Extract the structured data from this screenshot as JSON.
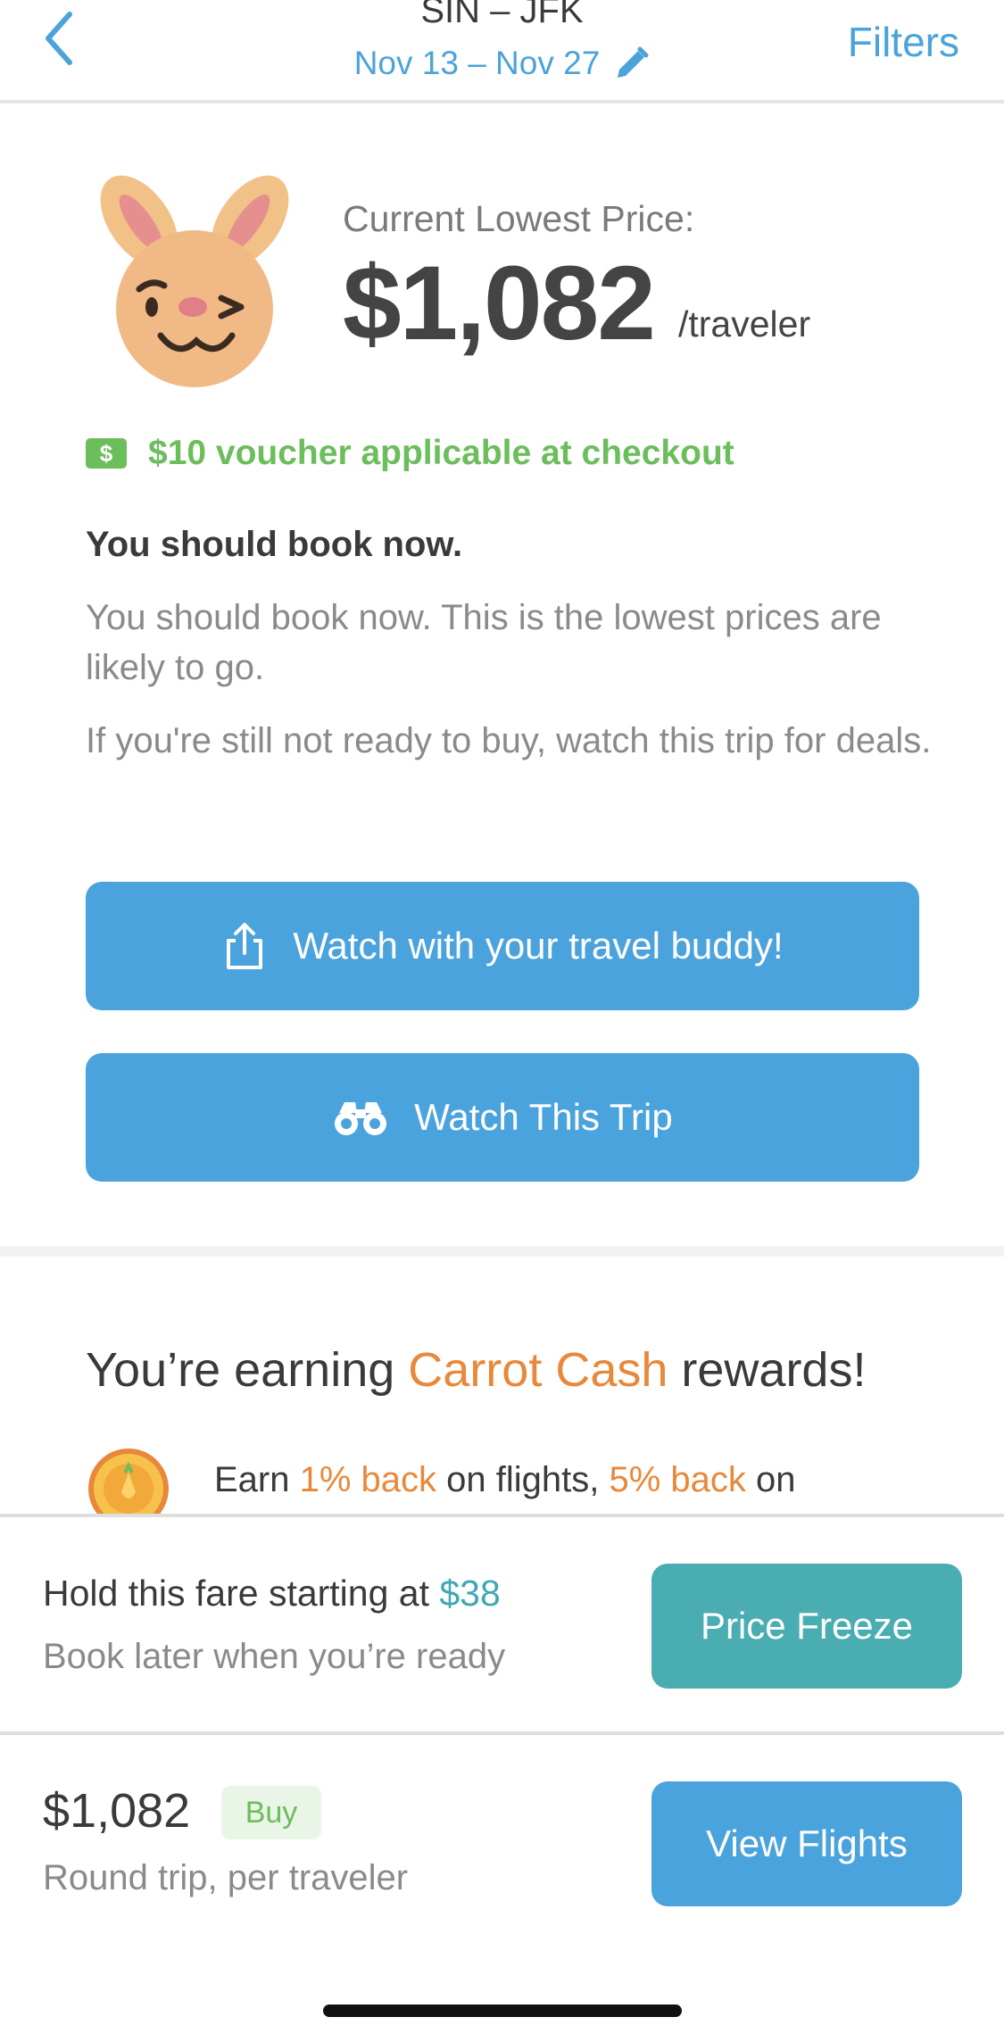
{
  "header": {
    "route": "SIN – JFK",
    "dates": "Nov 13 – Nov 27",
    "filters_label": "Filters"
  },
  "price_card": {
    "label": "Current Lowest Price:",
    "price": "$1,082",
    "unit": "/traveler",
    "voucher_icon_text": "$",
    "voucher_text": "$10 voucher applicable at checkout",
    "advice_title": "You should book now.",
    "advice_1": "You should book now. This is the lowest prices are likely to go.",
    "advice_2": "If you're still not ready to buy, watch this trip for deals.",
    "share_button": "Watch with your travel buddy!",
    "watch_button": "Watch This Trip"
  },
  "rewards": {
    "title_pre": "You’re earning ",
    "title_highlight": "Carrot Cash",
    "title_post": " rewards!",
    "line_1": "Earn ",
    "line_hl_1": "1% back",
    "line_2": " on flights, ",
    "line_hl_2": "5% back",
    "line_3": " on"
  },
  "bottom_sheet": {
    "hold_pre": "Hold this fare starting at ",
    "hold_price": "$38",
    "hold_sub": "Book later when you’re ready",
    "freeze_button": "Price Freeze",
    "price": "$1,082",
    "badge": "Buy",
    "sub": "Round trip, per traveler",
    "view_button": "View Flights"
  },
  "colors": {
    "accent_blue": "#4ba3dd",
    "teal": "#4aadb1",
    "green": "#6cbd5c",
    "orange": "#e8883a"
  },
  "icons": [
    "back-chevron-icon",
    "edit-pencil-icon",
    "bunny-wink-icon",
    "voucher-icon",
    "share-icon",
    "binoculars-icon",
    "carrot-coin-icon"
  ]
}
